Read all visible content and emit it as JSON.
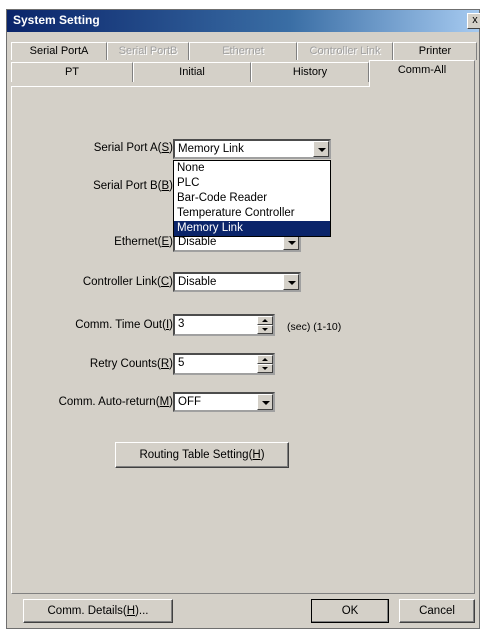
{
  "window": {
    "title": "System Setting",
    "close_glyph": "x"
  },
  "tabs_row1": [
    {
      "label": "Serial PortA",
      "disabled": false
    },
    {
      "label": "Serial PortB",
      "disabled": true
    },
    {
      "label": "Ethernet",
      "disabled": true
    },
    {
      "label": "Controller Link",
      "disabled": true
    },
    {
      "label": "Printer",
      "disabled": false
    }
  ],
  "tabs_row2": [
    {
      "label": "PT"
    },
    {
      "label": "Initial"
    },
    {
      "label": "History"
    },
    {
      "label": "Comm-All",
      "active": true
    }
  ],
  "form": {
    "serial_port_a": {
      "label": "Serial Port A",
      "key": "S",
      "value": "Memory Link"
    },
    "serial_port_b": {
      "label": "Serial Port B",
      "key": "B"
    },
    "ethernet": {
      "label": "Ethernet",
      "key": "E",
      "value": "Disable"
    },
    "controller_link": {
      "label": "Controller Link",
      "key": "C",
      "value": "Disable"
    },
    "comm_timeout": {
      "label": "Comm. Time Out",
      "key": "I",
      "value": "3",
      "unit": "(sec) (1-10)"
    },
    "retry_counts": {
      "label": "Retry Counts",
      "key": "R",
      "value": "5"
    },
    "comm_auto_return": {
      "label": "Comm. Auto-return",
      "key": "M",
      "value": "OFF"
    }
  },
  "dropdown_options": [
    {
      "label": "None"
    },
    {
      "label": "PLC"
    },
    {
      "label": "Bar-Code Reader"
    },
    {
      "label": "Temperature Controller"
    },
    {
      "label": "Memory Link",
      "selected": true
    }
  ],
  "routing_button": {
    "label": "Routing Table Setting",
    "key": "H"
  },
  "footer": {
    "comm_details": {
      "label": "Comm. Details",
      "key": "H",
      "suffix": "..."
    },
    "ok": "OK",
    "cancel": "Cancel"
  },
  "colors": {
    "titlebar": "#0a246a",
    "face": "#d4d0c8",
    "selection": "#0a246a"
  }
}
